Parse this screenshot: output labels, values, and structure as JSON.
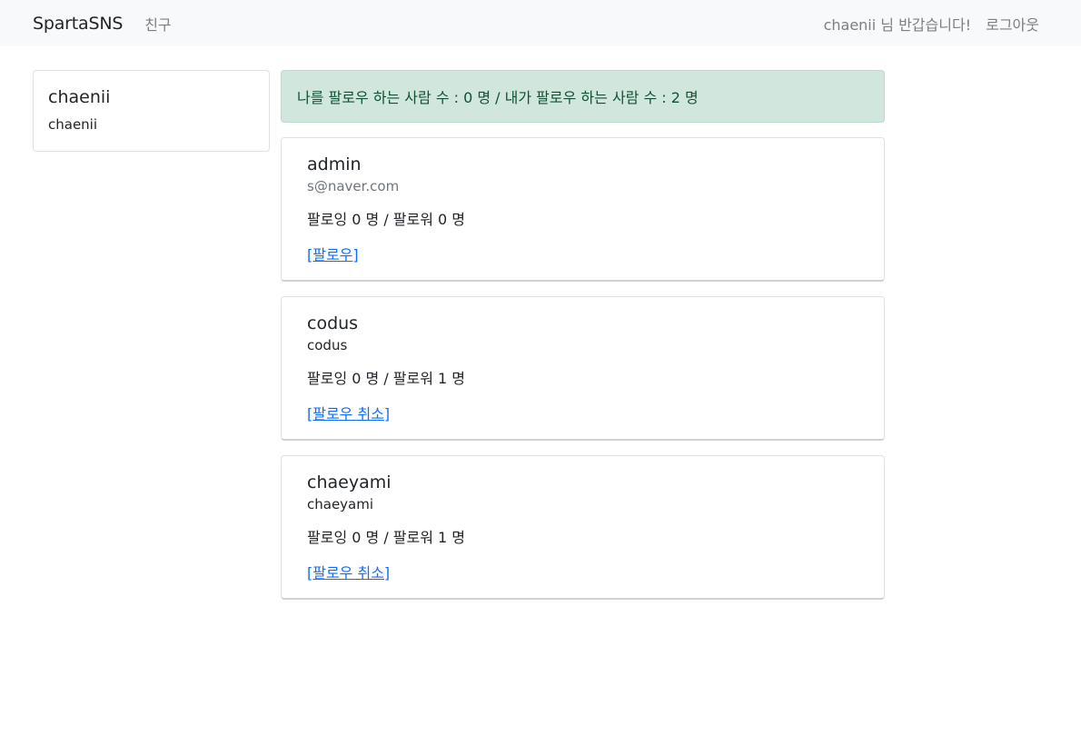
{
  "navbar": {
    "brand": "SpartaSNS",
    "friends_link": "친구",
    "greeting": "chaenii 님 반갑습니다!",
    "logout_link": "로그아웃"
  },
  "profile": {
    "name": "chaenii",
    "sub": "chaenii"
  },
  "alert": {
    "text": "나를 팔로우 하는 사람 수 : 0 명 / 내가 팔로우 하는 사람 수 : 2 명"
  },
  "friends": [
    {
      "name": "admin",
      "sub": "s@naver.com",
      "stats": "팔로잉 0 명 / 팔로워 0 명",
      "action": "[팔로우]"
    },
    {
      "name": "codus",
      "sub": "codus",
      "stats": "팔로잉 0 명 / 팔로워 1 명",
      "action": "[팔로우 취소]"
    },
    {
      "name": "chaeyami",
      "sub": "chaeyami",
      "stats": "팔로잉 0 명 / 팔로워 1 명",
      "action": "[팔로우 취소]"
    }
  ]
}
